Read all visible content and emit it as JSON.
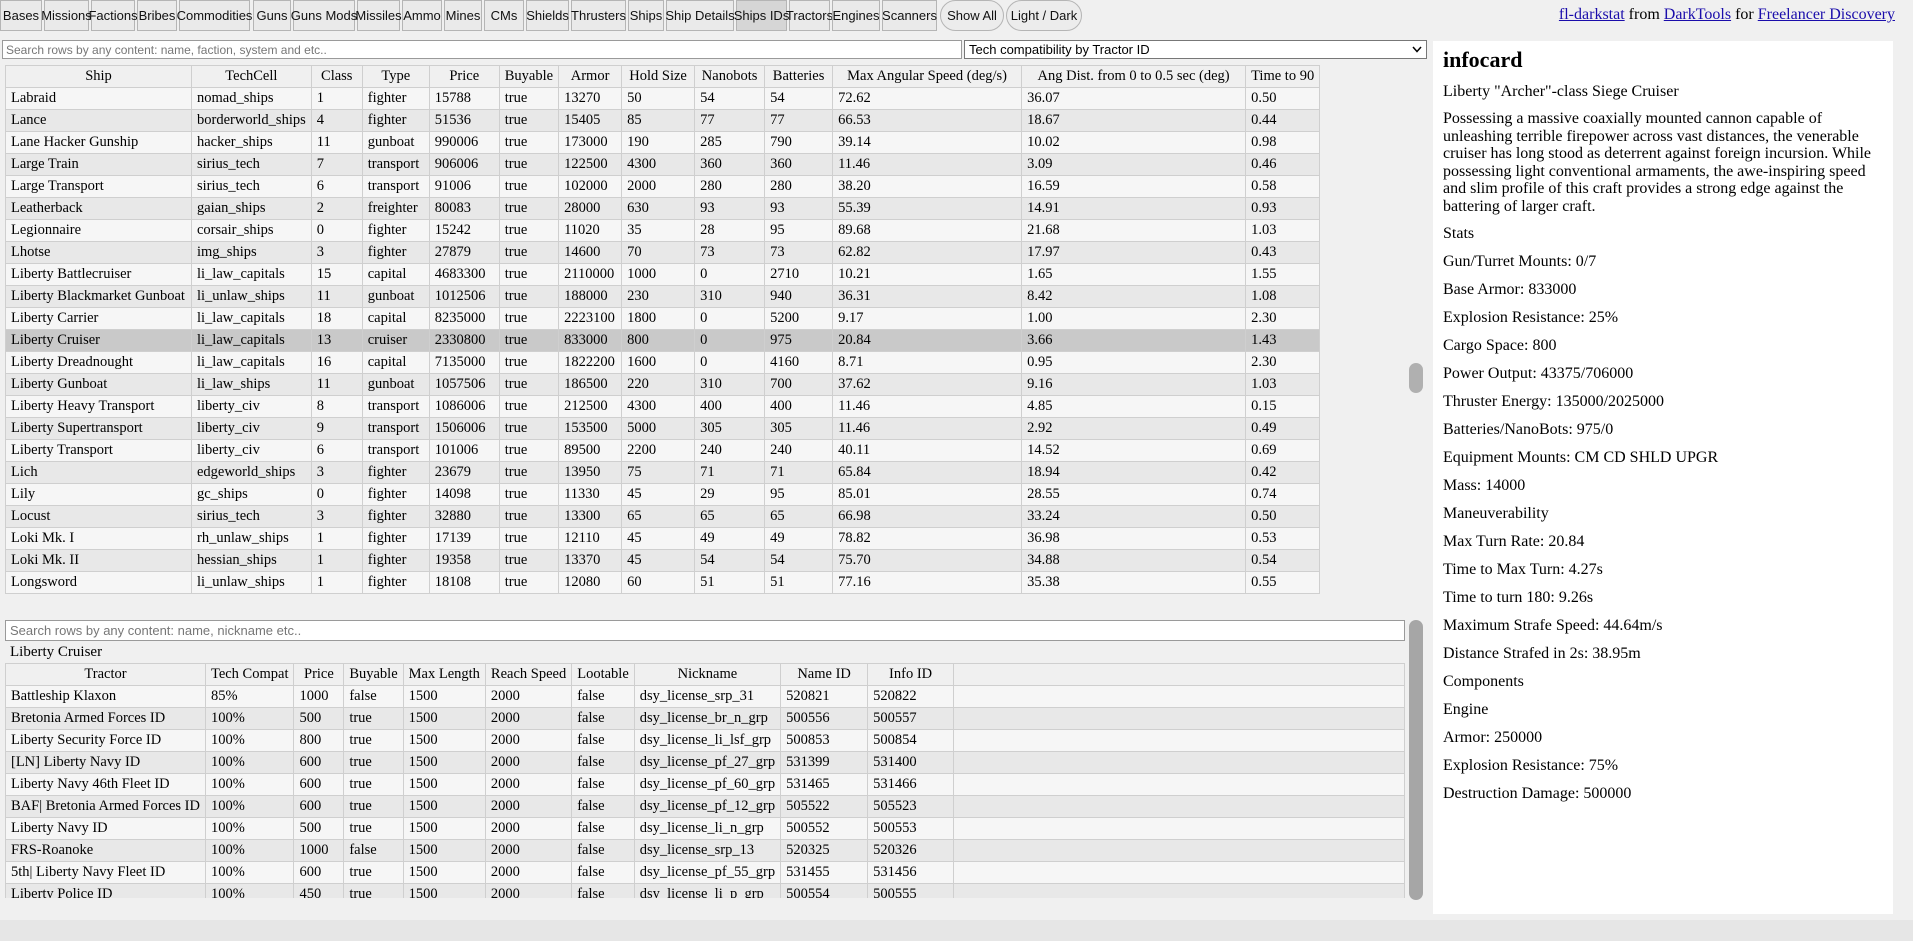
{
  "tabs": [
    {
      "label": "Bases",
      "active": false
    },
    {
      "label": "Missions",
      "active": false
    },
    {
      "label": "Factions",
      "active": false
    },
    {
      "label": "Bribes",
      "active": false
    },
    {
      "label": "Commodities",
      "active": false
    },
    {
      "label": "Guns",
      "active": false
    },
    {
      "label": "Guns Mods",
      "active": false
    },
    {
      "label": "Missiles",
      "active": false
    },
    {
      "label": "Ammo",
      "active": false
    },
    {
      "label": "Mines",
      "active": false
    },
    {
      "label": "CMs",
      "active": false
    },
    {
      "label": "Shields",
      "active": false
    },
    {
      "label": "Thrusters",
      "active": false
    },
    {
      "label": "Ships",
      "active": false
    },
    {
      "label": "Ship Details",
      "active": false
    },
    {
      "label": "Ships IDs",
      "active": true
    },
    {
      "label": "Tractors",
      "active": false
    },
    {
      "label": "Engines",
      "active": false
    },
    {
      "label": "Scanners",
      "active": false
    },
    {
      "label": "Show All",
      "active": false
    },
    {
      "label": "Light / Dark",
      "active": false
    }
  ],
  "brand": {
    "link1": "fl-darkstat",
    "text1": "from",
    "link2": "DarkTools",
    "text2": "for",
    "link3": "Freelancer Discovery"
  },
  "top_search": {
    "placeholder": "Search rows by any content: name, faction, system and etc.."
  },
  "tech_select": {
    "value": "Tech compatibility by Tractor ID"
  },
  "ship_table": {
    "headers": [
      "Ship",
      "TechCell",
      "Class",
      "Type",
      "Price",
      "Buyable",
      "Armor",
      "Hold Size",
      "Nanobots",
      "Batteries",
      "Max Angular Speed (deg/s)",
      "Ang Dist. from 0 to 0.5 sec (deg)",
      "Time to 90"
    ],
    "rows": [
      [
        "Labraid",
        "nomad_ships",
        "1",
        "fighter",
        "15788",
        "true",
        "13270",
        "50",
        "54",
        "54",
        "72.62",
        "36.07",
        "0.50"
      ],
      [
        "Lance",
        "borderworld_ships",
        "4",
        "fighter",
        "51536",
        "true",
        "15405",
        "85",
        "77",
        "77",
        "66.53",
        "18.67",
        "0.44"
      ],
      [
        "Lane Hacker Gunship",
        "hacker_ships",
        "11",
        "gunboat",
        "990006",
        "true",
        "173000",
        "190",
        "285",
        "790",
        "39.14",
        "10.02",
        "0.98"
      ],
      [
        "Large Train",
        "sirius_tech",
        "7",
        "transport",
        "906006",
        "true",
        "122500",
        "4300",
        "360",
        "360",
        "11.46",
        "3.09",
        "0.46"
      ],
      [
        "Large Transport",
        "sirius_tech",
        "6",
        "transport",
        "91006",
        "true",
        "102000",
        "2000",
        "280",
        "280",
        "38.20",
        "16.59",
        "0.58"
      ],
      [
        "Leatherback",
        "gaian_ships",
        "2",
        "freighter",
        "80083",
        "true",
        "28000",
        "630",
        "93",
        "93",
        "55.39",
        "14.91",
        "0.93"
      ],
      [
        "Legionnaire",
        "corsair_ships",
        "0",
        "fighter",
        "15242",
        "true",
        "11020",
        "35",
        "28",
        "95",
        "89.68",
        "21.68",
        "1.03"
      ],
      [
        "Lhotse",
        "img_ships",
        "3",
        "fighter",
        "27879",
        "true",
        "14600",
        "70",
        "73",
        "73",
        "62.82",
        "17.97",
        "0.43"
      ],
      [
        "Liberty Battlecruiser",
        "li_law_capitals",
        "15",
        "capital",
        "4683300",
        "true",
        "2110000",
        "1000",
        "0",
        "2710",
        "10.21",
        "1.65",
        "1.55"
      ],
      [
        "Liberty Blackmarket Gunboat",
        "li_unlaw_ships",
        "11",
        "gunboat",
        "1012506",
        "true",
        "188000",
        "230",
        "310",
        "940",
        "36.31",
        "8.42",
        "1.08"
      ],
      [
        "Liberty Carrier",
        "li_law_capitals",
        "18",
        "capital",
        "8235000",
        "true",
        "2223100",
        "1800",
        "0",
        "5200",
        "9.17",
        "1.00",
        "2.30"
      ],
      [
        "Liberty Cruiser",
        "li_law_capitals",
        "13",
        "cruiser",
        "2330800",
        "true",
        "833000",
        "800",
        "0",
        "975",
        "20.84",
        "3.66",
        "1.43"
      ],
      [
        "Liberty Dreadnought",
        "li_law_capitals",
        "16",
        "capital",
        "7135000",
        "true",
        "1822200",
        "1600",
        "0",
        "4160",
        "8.71",
        "0.95",
        "2.30"
      ],
      [
        "Liberty Gunboat",
        "li_law_ships",
        "11",
        "gunboat",
        "1057506",
        "true",
        "186500",
        "220",
        "310",
        "700",
        "37.62",
        "9.16",
        "1.03"
      ],
      [
        "Liberty Heavy Transport",
        "liberty_civ",
        "8",
        "transport",
        "1086006",
        "true",
        "212500",
        "4300",
        "400",
        "400",
        "11.46",
        "4.85",
        "0.15"
      ],
      [
        "Liberty Supertransport",
        "liberty_civ",
        "9",
        "transport",
        "1506006",
        "true",
        "153500",
        "5000",
        "305",
        "305",
        "11.46",
        "2.92",
        "0.49"
      ],
      [
        "Liberty Transport",
        "liberty_civ",
        "6",
        "transport",
        "101006",
        "true",
        "89500",
        "2200",
        "240",
        "240",
        "40.11",
        "14.52",
        "0.69"
      ],
      [
        "Lich",
        "edgeworld_ships",
        "3",
        "fighter",
        "23679",
        "true",
        "13950",
        "75",
        "71",
        "71",
        "65.84",
        "18.94",
        "0.42"
      ],
      [
        "Lily",
        "gc_ships",
        "0",
        "fighter",
        "14098",
        "true",
        "11330",
        "45",
        "29",
        "95",
        "85.01",
        "28.55",
        "0.74"
      ],
      [
        "Locust",
        "sirius_tech",
        "3",
        "fighter",
        "32880",
        "true",
        "13300",
        "65",
        "65",
        "65",
        "66.98",
        "33.24",
        "0.50"
      ],
      [
        "Loki Mk. I",
        "rh_unlaw_ships",
        "1",
        "fighter",
        "17139",
        "true",
        "12110",
        "45",
        "49",
        "49",
        "78.82",
        "36.98",
        "0.53"
      ],
      [
        "Loki Mk. II",
        "hessian_ships",
        "1",
        "fighter",
        "19358",
        "true",
        "13370",
        "45",
        "54",
        "54",
        "75.70",
        "34.88",
        "0.54"
      ],
      [
        "Longsword",
        "li_unlaw_ships",
        "1",
        "fighter",
        "18108",
        "true",
        "12080",
        "60",
        "51",
        "51",
        "77.16",
        "35.38",
        "0.55"
      ]
    ],
    "selected_index": 11
  },
  "bottom_search": {
    "placeholder": "Search rows by any content: name, nickname etc.."
  },
  "selected_ship": "Liberty Cruiser",
  "tractor_table": {
    "headers": [
      "Tractor",
      "Tech Compat",
      "Price",
      "Buyable",
      "Max Length",
      "Reach Speed",
      "Lootable",
      "Nickname",
      "Name ID",
      "Info ID",
      ""
    ],
    "rows": [
      [
        "Battleship Klaxon",
        "85%",
        "1000",
        "false",
        "1500",
        "2000",
        "false",
        "dsy_license_srp_31",
        "520821",
        "520822",
        ""
      ],
      [
        "Bretonia Armed Forces ID",
        "100%",
        "500",
        "true",
        "1500",
        "2000",
        "false",
        "dsy_license_br_n_grp",
        "500556",
        "500557",
        ""
      ],
      [
        "Liberty Security Force ID",
        "100%",
        "800",
        "true",
        "1500",
        "2000",
        "false",
        "dsy_license_li_lsf_grp",
        "500853",
        "500854",
        ""
      ],
      [
        "[LN] Liberty Navy ID",
        "100%",
        "600",
        "true",
        "1500",
        "2000",
        "false",
        "dsy_license_pf_27_grp",
        "531399",
        "531400",
        ""
      ],
      [
        "Liberty Navy 46th Fleet ID",
        "100%",
        "600",
        "true",
        "1500",
        "2000",
        "false",
        "dsy_license_pf_60_grp",
        "531465",
        "531466",
        ""
      ],
      [
        "BAF| Bretonia Armed Forces ID",
        "100%",
        "600",
        "true",
        "1500",
        "2000",
        "false",
        "dsy_license_pf_12_grp",
        "505522",
        "505523",
        ""
      ],
      [
        "Liberty Navy ID",
        "100%",
        "500",
        "true",
        "1500",
        "2000",
        "false",
        "dsy_license_li_n_grp",
        "500552",
        "500553",
        ""
      ],
      [
        "FRS-Roanoke",
        "100%",
        "1000",
        "false",
        "1500",
        "2000",
        "false",
        "dsy_license_srp_13",
        "520325",
        "520326",
        ""
      ],
      [
        "5th| Liberty Navy Fleet ID",
        "100%",
        "600",
        "true",
        "1500",
        "2000",
        "false",
        "dsy_license_pf_55_grp",
        "531455",
        "531456",
        ""
      ],
      [
        "Liberty Police ID",
        "100%",
        "450",
        "true",
        "1500",
        "2000",
        "false",
        "dsy_license_li_p_grp",
        "500554",
        "500555",
        ""
      ]
    ]
  },
  "infocard": {
    "title": "infocard",
    "subtitle": "Liberty \"Archer\"-class Siege Cruiser",
    "description": "Possessing a massive coaxially mounted cannon capable of unleashing terrible firepower across vast distances, the venerable cruiser has long stood as deterrent against foreign incursion. While possessing light conventional armaments, the awe-inspiring speed and slim profile of this craft provides a strong edge against the battering of larger craft.",
    "lines": [
      "Stats",
      "Gun/Turret Mounts: 0/7",
      "Base Armor: 833000",
      "Explosion Resistance: 25%",
      "Cargo Space: 800",
      "Power Output: 43375/706000",
      "Thruster Energy: 135000/2025000",
      "Batteries/NanoBots: 975/0",
      "Equipment Mounts: CM CD SHLD UPGR",
      "Mass: 14000",
      "Maneuverability",
      "Max Turn Rate: 20.84",
      "Time to Max Turn: 4.27s",
      "Time to turn 180: 9.26s",
      "Maximum Strafe Speed: 44.64m/s",
      "Distance Strafed in 2s: 38.95m",
      "Components",
      "Engine",
      "Armor: 250000",
      "Explosion Resistance: 75%",
      "Destruction Damage: 500000"
    ]
  }
}
